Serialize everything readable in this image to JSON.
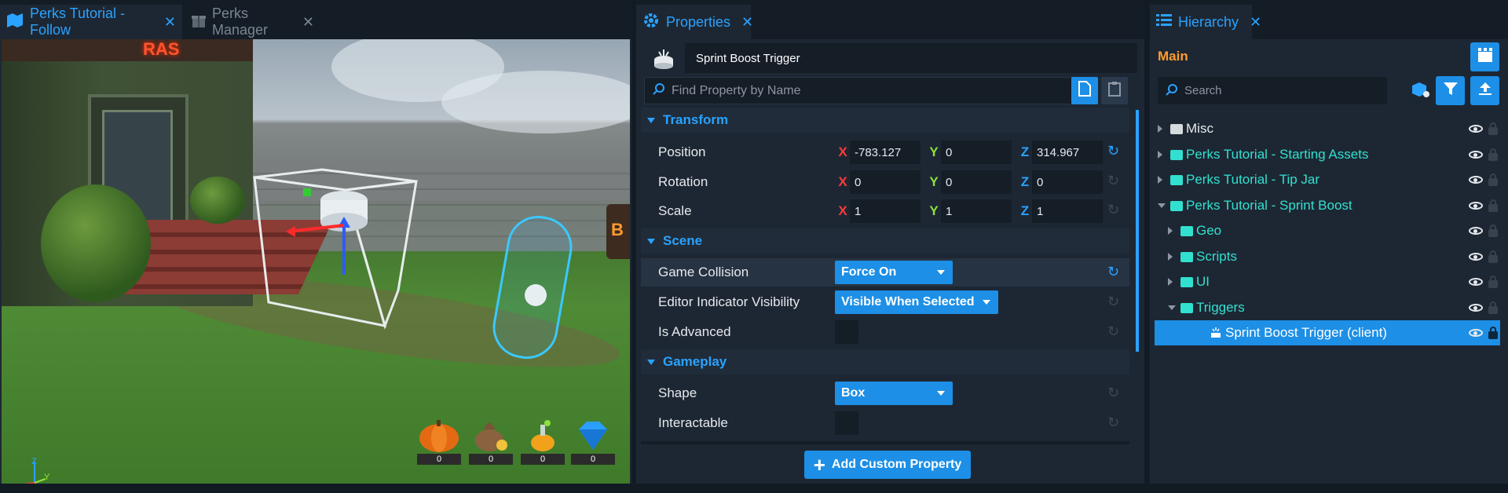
{
  "viewport": {
    "tabs": [
      {
        "label": "Perks Tutorial - Follow",
        "close": "✕"
      },
      {
        "label": "Perks Manager",
        "close": "✕"
      }
    ],
    "scene_sign": "RAS",
    "barrel_text": "B",
    "hud_counts": [
      "0",
      "0",
      "0",
      "0"
    ],
    "gizmo_axes": {
      "x": "x",
      "y": "Y",
      "z": "Z"
    }
  },
  "properties": {
    "tab": {
      "label": "Properties",
      "close": "✕"
    },
    "object_name": "Sprint Boost Trigger",
    "find_placeholder": "Find Property by Name",
    "sections": {
      "transform": "Transform",
      "scene": "Scene",
      "gameplay": "Gameplay"
    },
    "transform": {
      "position": {
        "label": "Position",
        "x": "-783.127",
        "y": "0",
        "z": "314.967"
      },
      "rotation": {
        "label": "Rotation",
        "x": "0",
        "y": "0",
        "z": "0"
      },
      "scale": {
        "label": "Scale",
        "x": "1",
        "y": "1",
        "z": "1"
      },
      "axis_labels": {
        "x": "X",
        "y": "Y",
        "z": "Z"
      }
    },
    "scene": {
      "game_collision": {
        "label": "Game Collision",
        "value": "Force On"
      },
      "editor_indicator": {
        "label": "Editor Indicator Visibility",
        "value": "Visible When Selected"
      },
      "is_advanced": {
        "label": "Is Advanced"
      }
    },
    "gameplay": {
      "shape": {
        "label": "Shape",
        "value": "Box"
      },
      "interactable": {
        "label": "Interactable"
      }
    },
    "add_custom_property": "Add Custom Property",
    "add_icon": "+"
  },
  "hierarchy": {
    "tab": {
      "label": "Hierarchy",
      "close": "✕"
    },
    "root_label": "Main",
    "search_placeholder": "Search",
    "items": [
      {
        "label": "Misc",
        "color": "#e6e9ee"
      },
      {
        "label": "Perks Tutorial - Starting Assets",
        "color": "#32e0d0"
      },
      {
        "label": "Perks Tutorial - Tip Jar",
        "color": "#32e0d0"
      },
      {
        "label": "Perks Tutorial - Sprint Boost",
        "color": "#32e0d0"
      },
      {
        "label": "Geo",
        "color": "#32e0d0"
      },
      {
        "label": "Scripts",
        "color": "#32e0d0"
      },
      {
        "label": "UI",
        "color": "#32e0d0"
      },
      {
        "label": "Triggers",
        "color": "#32e0d0"
      },
      {
        "label": "Sprint Boost Trigger (client)",
        "color": "#ffffff"
      }
    ]
  },
  "colors": {
    "accent": "#2aa2ff",
    "button": "#1d8fe6",
    "axis_x": "#ff3b3b",
    "axis_y": "#8ee13a",
    "axis_z": "#2aa2ff",
    "main_label": "#ff9d2e",
    "folder_teal": "#32e0d0"
  }
}
